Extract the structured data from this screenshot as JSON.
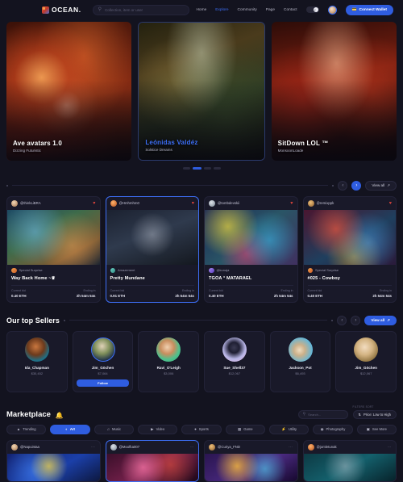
{
  "header": {
    "brand": "OCEAN.",
    "search_placeholder": "Collection, item or user",
    "search_icon": "search-icon",
    "nav": [
      {
        "label": "Home",
        "active": false
      },
      {
        "label": "Explore",
        "active": true
      },
      {
        "label": "Community",
        "active": false
      },
      {
        "label": "Page",
        "active": false
      },
      {
        "label": "Contact",
        "active": false
      }
    ],
    "theme_toggle_icon": "moon-icon",
    "avatar": "user-avatar",
    "wallet_button": {
      "label": "Connect Wallet",
      "icon": "wallet-icon"
    }
  },
  "hero": {
    "slides": [
      {
        "title": "Ave avatars 1.0",
        "subtitle": "Dizzing Futuristic",
        "accent": false
      },
      {
        "title": "Leónidas Valdéz",
        "subtitle": "Solstice Dreams",
        "accent": true
      },
      {
        "title": "SitDown LOL ™",
        "subtitle": "MonsoonLoade",
        "accent": false
      }
    ],
    "dots": [
      false,
      true,
      false,
      false
    ]
  },
  "live_auctions": {
    "nav": {
      "prev_icon": "chevron-left-icon",
      "next_icon": "chevron-right-icon",
      "view_all": "View all",
      "view_all_icon": "arrow-up-right-icon"
    },
    "cards": [
      {
        "handle": "@thinkLiBRA",
        "badge": "Special Surprise",
        "name": "Way Back Home ~♛",
        "bid_label": "Current bid",
        "bid_value": "0.40 ETH",
        "ending_label": "Ending in",
        "ending_value": "2h 54m 54s",
        "liked": true,
        "selected": false
      },
      {
        "handle": "@Hmhmhm0",
        "badge": "Amazement",
        "name": "Pretty Mundane",
        "bid_label": "Current bid",
        "bid_value": "0.91 ETH",
        "ending_label": "Ending in",
        "ending_value": "2h 54m 54s",
        "liked": true,
        "selected": true
      },
      {
        "handle": "@tombdevskii",
        "badge": "@kunaja",
        "name": "TGOA ° MATARAEL",
        "bid_label": "Current bid",
        "bid_value": "0.40 ETH",
        "ending_label": "Ending in",
        "ending_value": "2h 54m 54s",
        "liked": true,
        "selected": false
      },
      {
        "handle": "@remixppk",
        "badge": "Special Surprise",
        "name": "#025 - Cowboy",
        "bid_label": "Current bid",
        "bid_value": "0.40 ETH",
        "ending_label": "Ending in",
        "ending_value": "2h 54m 54s",
        "liked": true,
        "selected": false
      }
    ]
  },
  "top_sellers": {
    "title": "Our top Sellers",
    "nav": {
      "prev_icon": "chevron-left-icon",
      "next_icon": "chevron-right-icon",
      "view_all": "View all",
      "view_all_icon": "arrow-up-right-icon"
    },
    "sellers": [
      {
        "name": "Ida_Chapman",
        "value": "$30,452",
        "follow": null
      },
      {
        "name": "Jim_Göchen",
        "value": "$7,064",
        "follow": "Follow"
      },
      {
        "name": "Ravi_O'Leigh",
        "value": "$3,006",
        "follow": null
      },
      {
        "name": "Sue_Shell37",
        "value": "$12,067",
        "follow": null
      },
      {
        "name": "Jackson_Pot",
        "value": "$6,493",
        "follow": null
      },
      {
        "name": "Jim_Göchen",
        "value": "$12,067",
        "follow": null
      }
    ]
  },
  "marketplace": {
    "title": "Marketplace",
    "title_icon": "bell-icon",
    "search_placeholder": "Search...",
    "search_icon": "search-icon",
    "filter_label": "FILTERS SORT",
    "filter_value": "Price: Low to High",
    "filter_icon": "sort-icon",
    "chips": [
      {
        "label": "Trending",
        "icon": "fire-icon",
        "active": false
      },
      {
        "label": "Art",
        "icon": "palette-icon",
        "active": true
      },
      {
        "label": "Music",
        "icon": "music-icon",
        "active": false
      },
      {
        "label": "Video",
        "icon": "video-icon",
        "active": false
      },
      {
        "label": "Sports",
        "icon": "ball-icon",
        "active": false
      },
      {
        "label": "Game",
        "icon": "gamepad-icon",
        "active": false
      },
      {
        "label": "Utility",
        "icon": "bolt-icon",
        "active": false
      },
      {
        "label": "Photography",
        "icon": "camera-icon",
        "active": false
      },
      {
        "label": "See More",
        "icon": "grid-icon",
        "active": false
      }
    ],
    "cards": [
      {
        "handle": "@Napuintaa",
        "menu_icon": "more-icon",
        "selected": false
      },
      {
        "handle": "@Moofka007",
        "menu_icon": "more-icon",
        "selected": true
      },
      {
        "handle": "@Curiya_FND",
        "menu_icon": "more-icon",
        "selected": false
      },
      {
        "handle": "@jomletunak",
        "menu_icon": "more-icon",
        "selected": false
      }
    ]
  },
  "colors": {
    "bg": "#13131f",
    "card": "#191929",
    "accent": "#2f5de0",
    "accent_text": "#3d6ef5",
    "heart": "#e0453c",
    "muted": "#6d6d87"
  }
}
